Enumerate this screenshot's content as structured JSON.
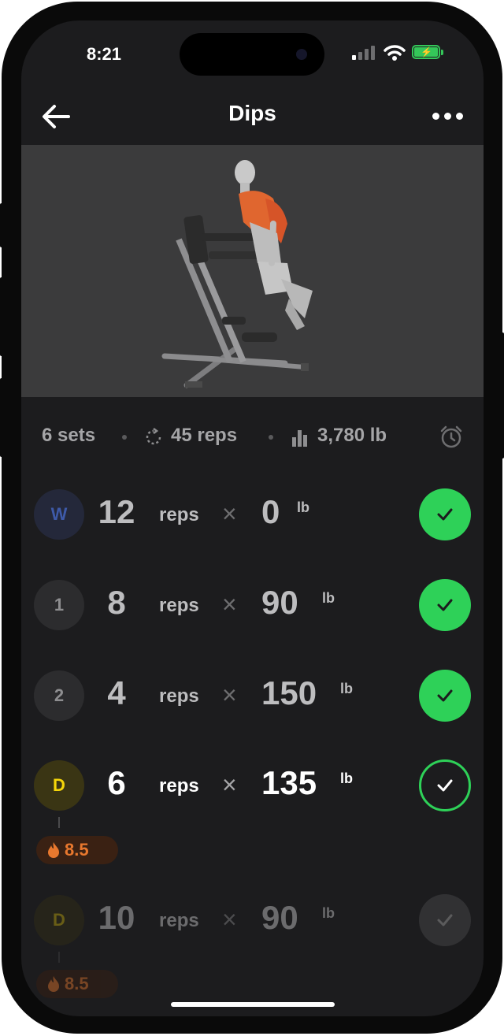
{
  "status": {
    "time": "8:21"
  },
  "nav": {
    "title": "Dips"
  },
  "summary": {
    "sets": "6 sets",
    "reps": "45 reps",
    "volume": "3,780 lb"
  },
  "sets": [
    {
      "badge": "W",
      "reps": "12",
      "reps_label": "reps",
      "times": "×",
      "weight": "0",
      "unit": "lb",
      "completed": true
    },
    {
      "badge": "1",
      "reps": "8",
      "reps_label": "reps",
      "times": "×",
      "weight": "90",
      "unit": "lb",
      "completed": true
    },
    {
      "badge": "2",
      "reps": "4",
      "reps_label": "reps",
      "times": "×",
      "weight": "150",
      "unit": "lb",
      "completed": true
    },
    {
      "badge": "D",
      "reps": "6",
      "reps_label": "reps",
      "times": "×",
      "weight": "135",
      "unit": "lb",
      "completed": false,
      "rpe": "8.5"
    },
    {
      "badge": "D",
      "reps": "10",
      "reps_label": "reps",
      "times": "×",
      "weight": "90",
      "unit": "lb",
      "completed": false,
      "rpe": "8.5"
    }
  ],
  "icons": [
    "back-arrow-icon",
    "more-icon",
    "reps-cycle-icon",
    "volume-bar-icon",
    "alarm-clock-icon",
    "checkmark-icon",
    "flame-icon"
  ],
  "colors": {
    "accent_green": "#2ed158",
    "warmup_blue": "#3e5aa8",
    "drop_yellow": "#f5d60a",
    "rpe_orange": "#e8782e"
  }
}
